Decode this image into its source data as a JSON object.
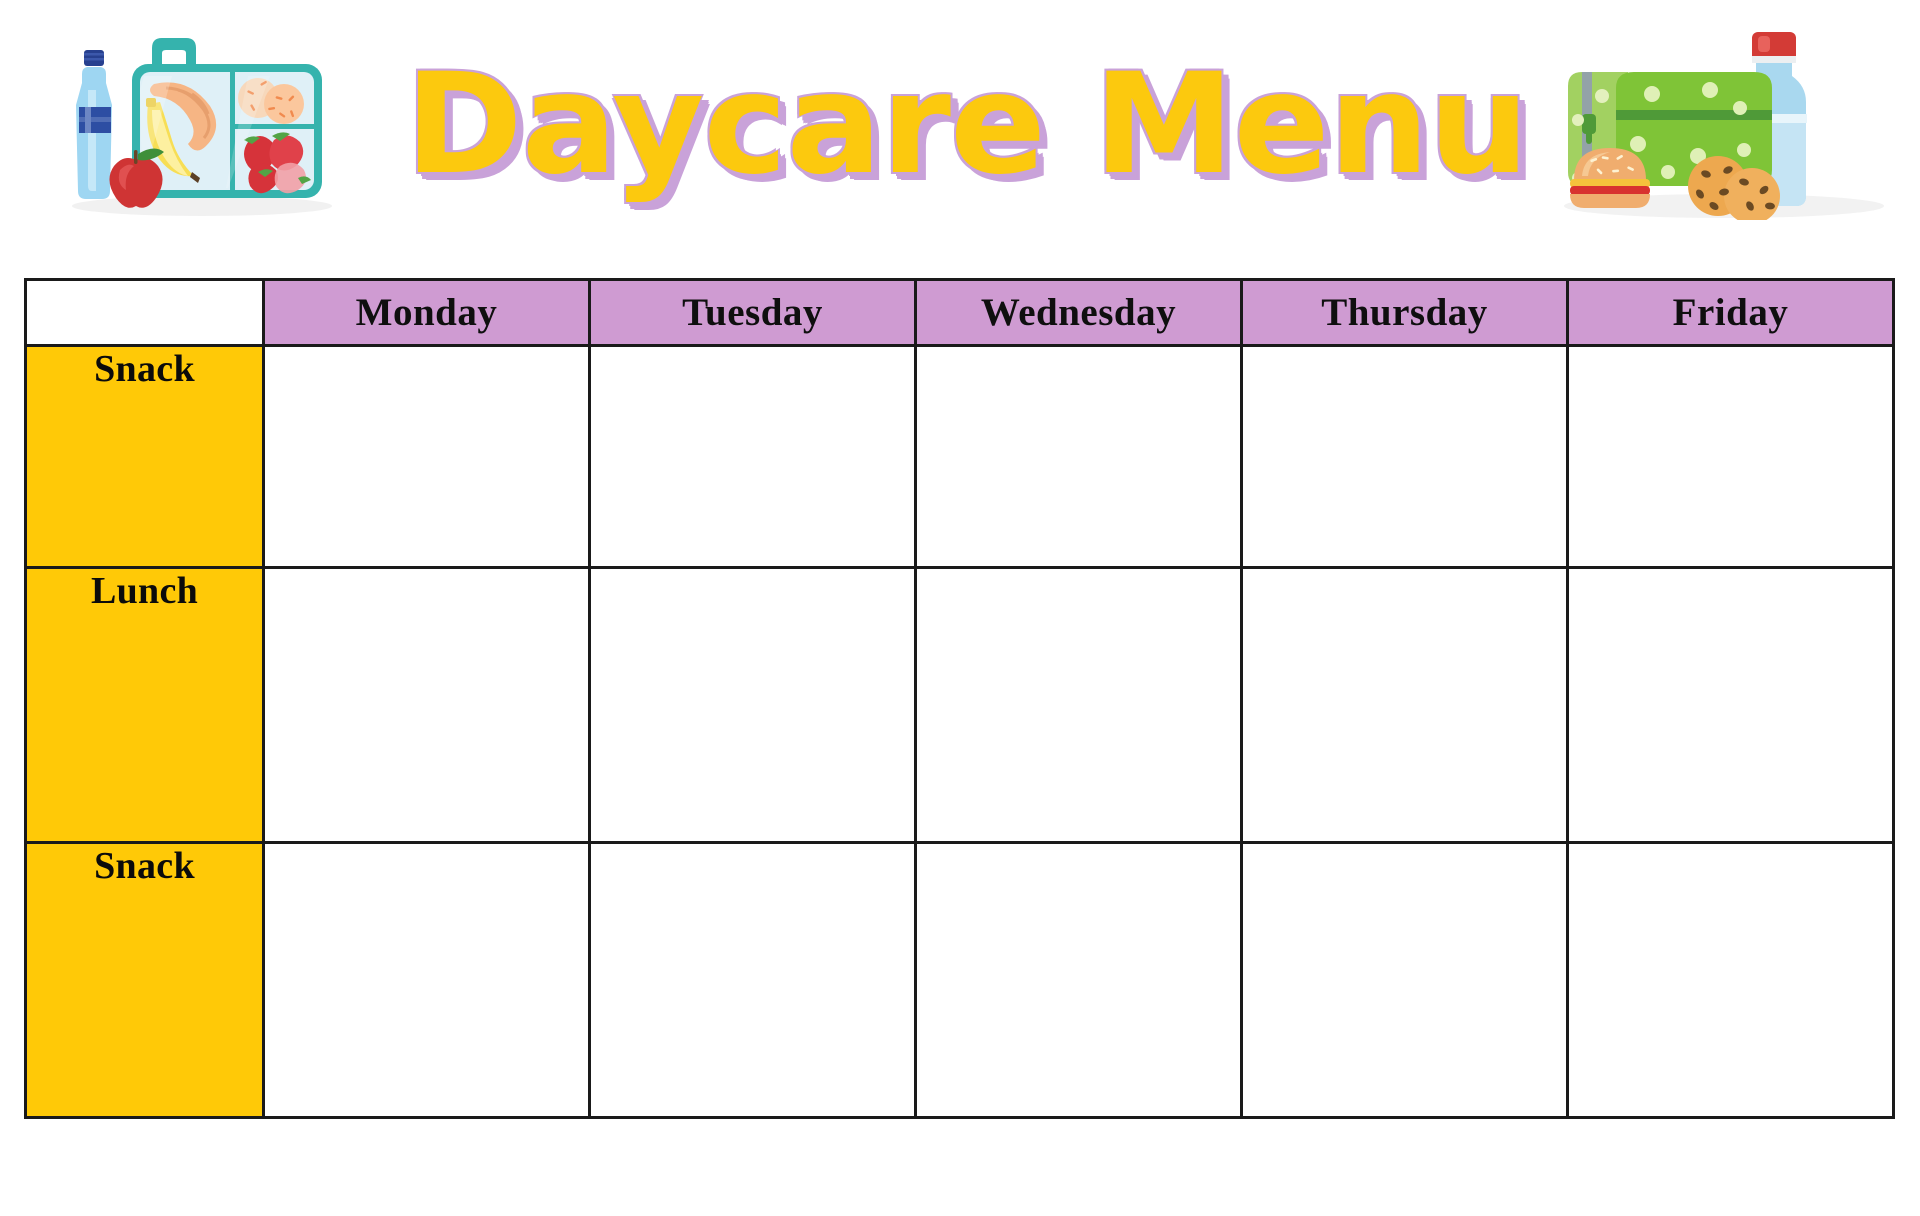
{
  "page": {
    "title": "Daycare Menu",
    "background_color": "#ffffff"
  },
  "colors": {
    "title_fill": "#FCC90E",
    "title_shadow": "#C9A2D9",
    "header_row": "#CF9BD2",
    "meal_column": "#FFC907",
    "grid_line": "#1a1a1a",
    "cell_background": "#ffffff"
  },
  "header": {
    "title": "Daycare Menu",
    "left_illustration": {
      "name": "lunchbox-with-water-bottle-fruit",
      "items": [
        "water-bottle",
        "apple",
        "banana",
        "lunchbox",
        "croissant",
        "cookies",
        "strawberries"
      ]
    },
    "right_illustration": {
      "name": "green-lunch-bag-with-milk-burger-cookies",
      "items": [
        "green-lunch-bag",
        "milk-bottle",
        "burger",
        "chocolate-chip-cookies"
      ]
    }
  },
  "table": {
    "corner_label": "",
    "column_headers": [
      "Monday",
      "Tuesday",
      "Wednesday",
      "Thursday",
      "Friday"
    ],
    "rows": [
      {
        "meal": "Snack",
        "cells": [
          "",
          "",
          "",
          "",
          ""
        ]
      },
      {
        "meal": "Lunch",
        "cells": [
          "",
          "",
          "",
          "",
          ""
        ]
      },
      {
        "meal": "Snack",
        "cells": [
          "",
          "",
          "",
          "",
          ""
        ]
      }
    ]
  }
}
